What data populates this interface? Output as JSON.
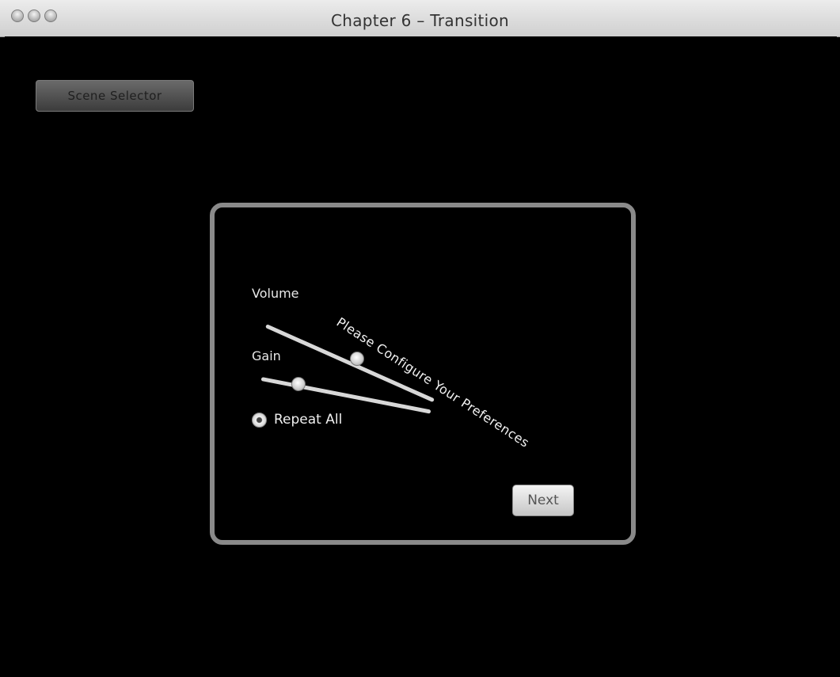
{
  "window": {
    "title": "Chapter 6 – Transition"
  },
  "scene_button": {
    "label": "Scene Selector"
  },
  "panel": {
    "volume_label": "Volume",
    "gain_label": "Gain",
    "volume_level": 0.5,
    "gain_level": 0.2,
    "repeat_label": "Repeat All",
    "repeat_selected": true,
    "prompt": "Please Configure Your Preferences",
    "next_label": "Next"
  }
}
